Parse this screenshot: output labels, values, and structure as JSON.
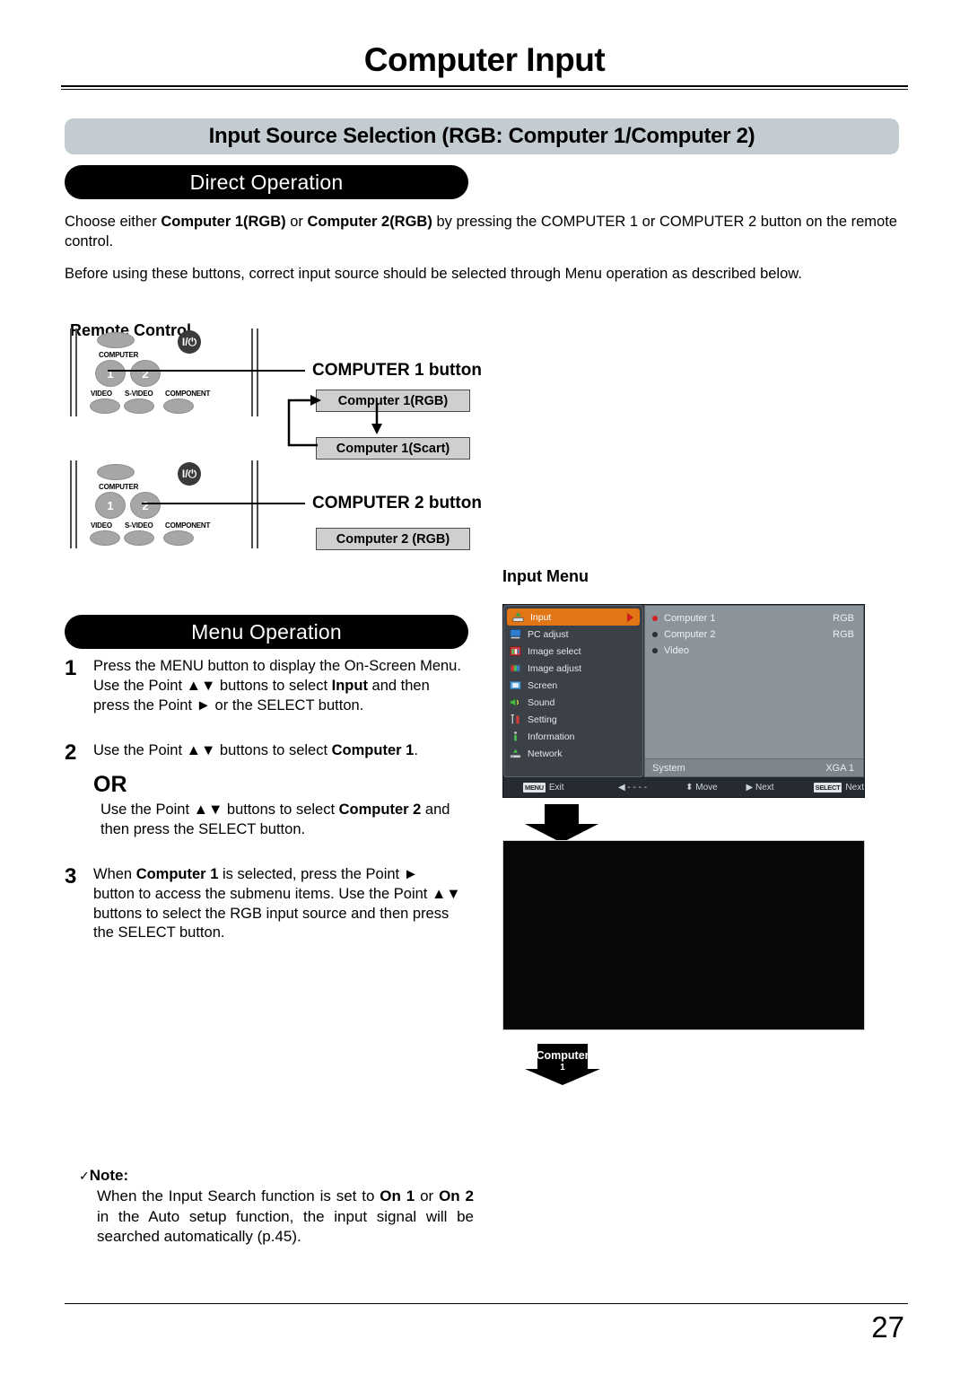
{
  "header": {
    "title": "Computer Input"
  },
  "section": {
    "banner": "Input Source Selection (RGB: Computer 1/Computer 2)",
    "direct_operation_pill": "Direct Operation",
    "menu_operation_pill": "Menu Operation"
  },
  "intro": {
    "line1_a": "Choose either ",
    "line1_b": "Computer 1(RGB)",
    "line1_c": " or ",
    "line1_d": "Computer 2(RGB)",
    "line1_e": " by pressing the COMPUTER 1 or COMPUTER 2 button on the remote control.",
    "line2": "Before using these buttons, correct input source should be selected through Menu operation as described below."
  },
  "remote_control": {
    "heading": "Remote Control",
    "labels": {
      "computer": "COMPUTER",
      "video": "VIDEO",
      "s_video": "S-VIDEO",
      "component": "COMPONENT",
      "power": "I/⏻",
      "btn1": "1",
      "btn2": "2"
    },
    "callout_1": "COMPUTER 1 button",
    "callout_2": "COMPUTER 2 button",
    "flow_1_rgb": "Computer 1(RGB)",
    "flow_1_scart": "Computer 1(Scart)",
    "flow_2_rgb": "Computer 2 (RGB)"
  },
  "steps": [
    {
      "num": "1",
      "text_a": "Press the MENU button to display the On-Screen Menu. Use the Point ▲▼ buttons to select ",
      "text_b": "Input",
      "text_c": " and then press the Point ► or the SELECT button."
    },
    {
      "num": "2",
      "text_a": "Use the Point ▲▼ buttons to select ",
      "text_b": "Computer 1",
      "text_c": "."
    },
    {
      "num": "3",
      "text_a": "When ",
      "text_b": "Computer 1",
      "text_c": " is selected, press the Point ► button to access the submenu items. Use the Point ▲▼ buttons to select the RGB input source and then press the SELECT button."
    }
  ],
  "or_block": {
    "word": "OR",
    "text_a": "Use the Point ▲▼ buttons to select ",
    "text_b": "Computer 2",
    "text_c": " and then press the SELECT button."
  },
  "input_menu": {
    "title": "Input Menu",
    "sidebar": [
      {
        "label": "Input",
        "icon": "input-icon",
        "active": true
      },
      {
        "label": "PC adjust",
        "icon": "pc-adjust-icon",
        "active": false
      },
      {
        "label": "Image select",
        "icon": "image-select-icon",
        "active": false
      },
      {
        "label": "Image adjust",
        "icon": "image-adjust-icon",
        "active": false
      },
      {
        "label": "Screen",
        "icon": "screen-icon",
        "active": false
      },
      {
        "label": "Sound",
        "icon": "sound-icon",
        "active": false
      },
      {
        "label": "Setting",
        "icon": "setting-icon",
        "active": false
      },
      {
        "label": "Information",
        "icon": "information-icon",
        "active": false
      },
      {
        "label": "Network",
        "icon": "network-icon",
        "active": false
      }
    ],
    "sources": [
      {
        "label": "Computer 1",
        "value": "RGB",
        "selected": true
      },
      {
        "label": "Computer 2",
        "value": "RGB",
        "selected": false
      },
      {
        "label": "Video",
        "value": "",
        "selected": false
      }
    ],
    "system_label": "System",
    "system_value": "XGA 1",
    "status_bar": [
      {
        "key": "MENU",
        "label": "Exit"
      },
      {
        "key": "",
        "label": "◀ - - - -"
      },
      {
        "key": "",
        "label": "⬍ Move"
      },
      {
        "key": "",
        "label": "▶ Next"
      },
      {
        "key": "SELECT",
        "label": "Next"
      }
    ]
  },
  "result_badge": {
    "line1": "Computer",
    "line2": "1"
  },
  "note": {
    "heading": "Note:",
    "check": "✓",
    "text_a": "When the Input Search function is set to ",
    "text_b": "On 1",
    "text_c": " or ",
    "text_d": "On 2",
    "text_e": " in the Auto setup function, the input signal will be searched automatically (p.45)."
  },
  "footer": {
    "page_number": "27"
  },
  "colors": {
    "banner_gray": "#c3ccd0",
    "pill_black": "#000000",
    "osd_orange": "#e07616",
    "osd_sidebar": "#3c4148",
    "osd_panel": "#8b949b",
    "osd_bar": "#262b31",
    "selected_dot_red": "#d32020"
  }
}
